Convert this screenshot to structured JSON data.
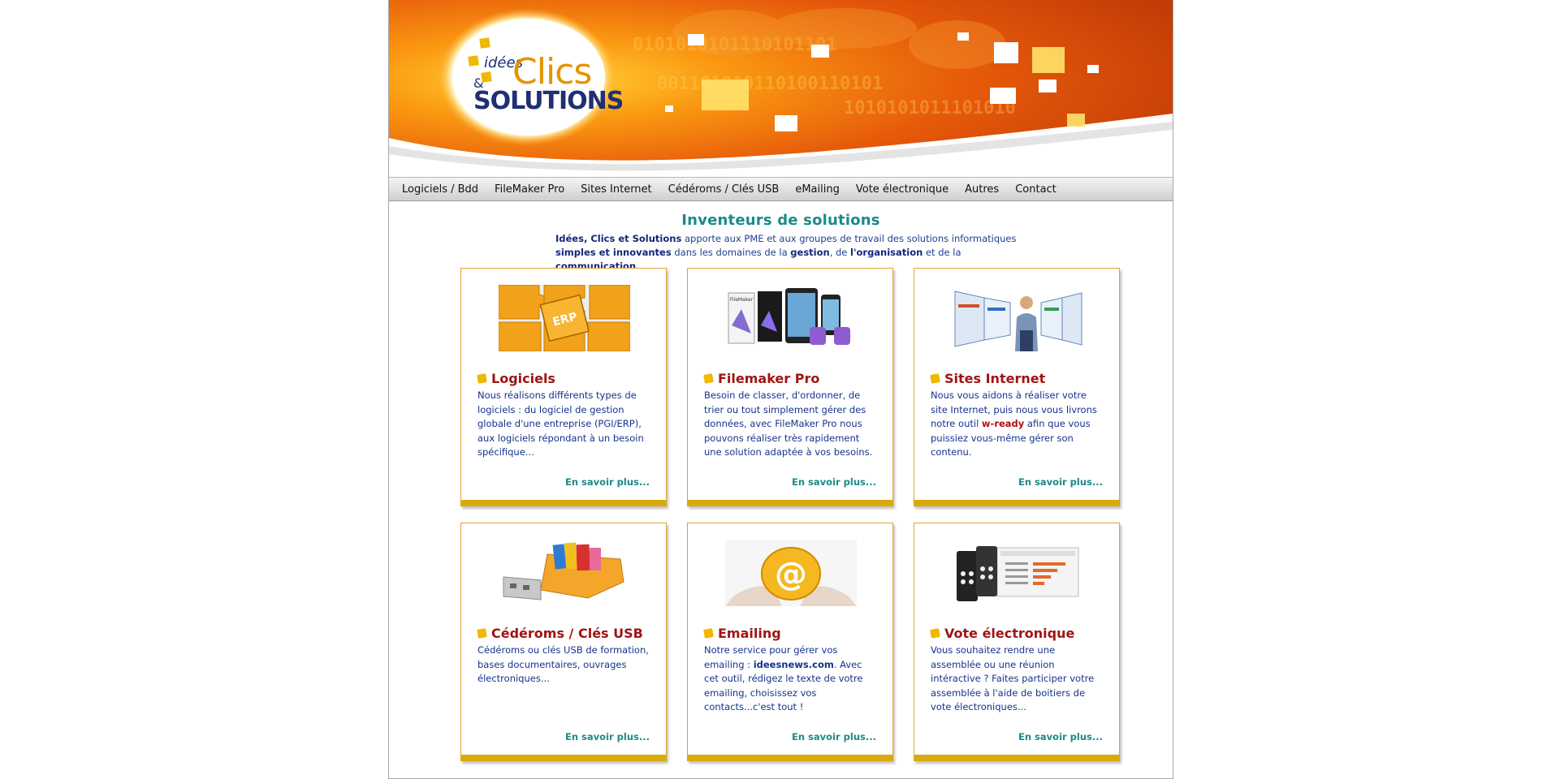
{
  "logo": {
    "idees": "idées",
    "amp": "&",
    "clics": "Clics",
    "solutions": "SOLUTIONS"
  },
  "nav": {
    "items": [
      {
        "label": "Logiciels / Bdd"
      },
      {
        "label": "FileMaker Pro"
      },
      {
        "label": "Sites Internet"
      },
      {
        "label": "Cédéroms / Clés USB"
      },
      {
        "label": "eMailing"
      },
      {
        "label": "Vote électronique"
      },
      {
        "label": "Autres"
      },
      {
        "label": "Contact"
      }
    ]
  },
  "intro": {
    "title": "Inventeurs de solutions",
    "line1_strong": "Idées, Clics et Solutions",
    "line1_rest": " apporte aux PME et aux groupes de travail des solutions informatiques",
    "line2_strong": "simples et innovantes",
    "line2_a": " dans les domaines de la ",
    "line2_gestion": "gestion",
    "line2_b": ", de ",
    "line2_organisation": "l'organisation",
    "line2_c": " et de la ",
    "line2_communication": "communication",
    "line2_d": "."
  },
  "cards": [
    {
      "icon": "erp-puzzle-image",
      "image_label": "ERP",
      "title": "Logiciels",
      "text": "Nous réalisons différents types de logiciels : du logiciel de gestion globale d'une entreprise (PGI/ERP), aux logiciels répondant à un besoin spécifique...",
      "more": "En savoir plus..."
    },
    {
      "icon": "filemaker-devices-image",
      "image_label": "FileMaker",
      "title": "Filemaker Pro",
      "text": "Besoin de classer, d'ordonner, de trier ou tout simplement gérer des données, avec FileMaker Pro nous pouvons réaliser très rapidement une solution adaptée à vos besoins.",
      "more": "En savoir plus..."
    },
    {
      "icon": "websites-man-image",
      "title": "Sites Internet",
      "text_a": "Nous vous aidons à réaliser votre site Internet, puis nous vous livrons notre outil ",
      "text_hl": "w-ready",
      "text_b": " afin que vous puissiez vous-même gérer son contenu.",
      "more": "En savoir plus..."
    },
    {
      "icon": "usb-key-image",
      "title": "Cédéroms / Clés USB",
      "text": "Cédéroms ou clés USB de formation, bases documentaires, ouvrages électroniques...",
      "more": "En savoir plus..."
    },
    {
      "icon": "email-at-image",
      "image_label": "@",
      "title": "Emailing",
      "text_a": "Notre service pour gérer vos emailing : ",
      "text_hl": "ideesnews.com",
      "text_b": ". Avec cet outil, rédigez le texte de votre emailing, choisissez vos contacts...c'est tout !",
      "more": "En savoir plus..."
    },
    {
      "icon": "voting-keypads-image",
      "title": "Vote électronique",
      "text": "Vous souhaitez rendre une assemblée ou une réunion intéractive ? Faites participer votre assemblée à l'aide de boitiers de vote électroniques...",
      "more": "En savoir plus..."
    }
  ],
  "colors": {
    "nav_bg": "#dcdcdc",
    "intro_title": "#1c8a88",
    "card_title": "#a01414",
    "card_text": "#14338c",
    "card_border": "#e8a030",
    "card_bottom": "#d8aa0c",
    "banner_orange": "#f07a10"
  }
}
